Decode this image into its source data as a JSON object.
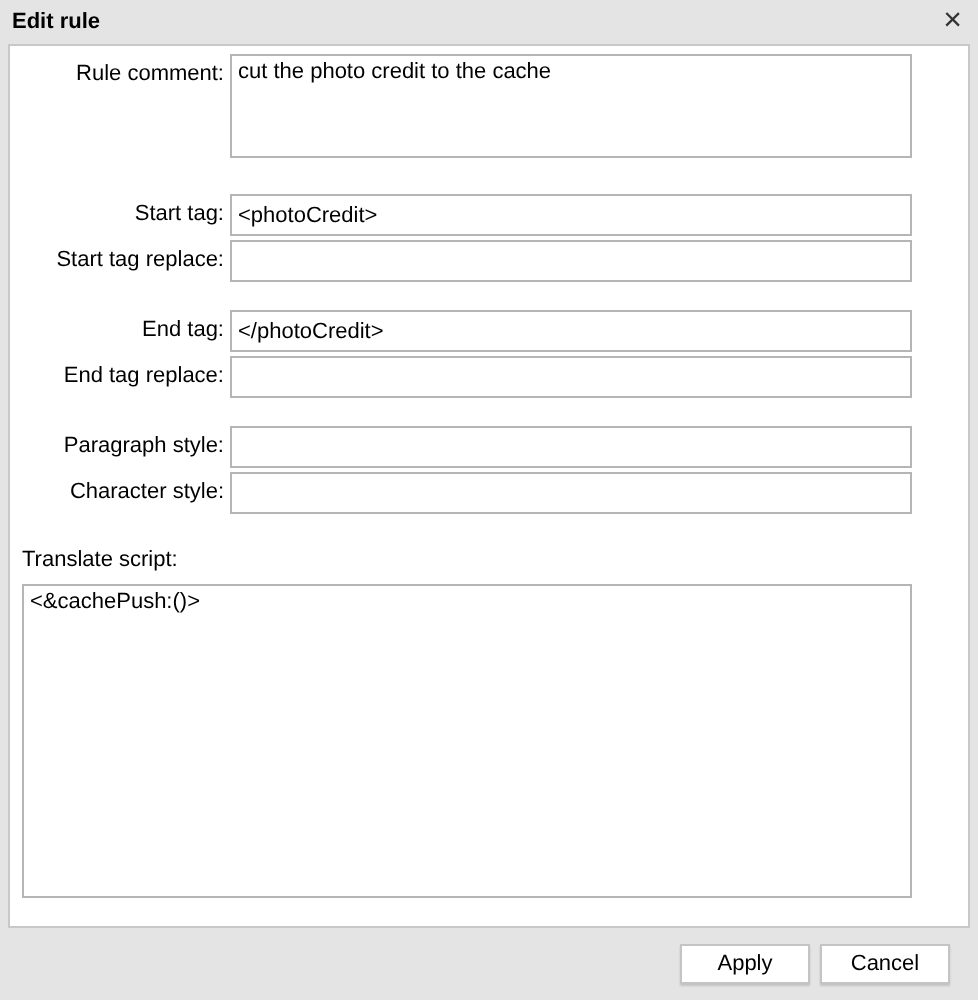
{
  "window": {
    "title": "Edit rule",
    "close": "×"
  },
  "field_groups": [
    [
      {
        "label": "Rule comment:",
        "kind": "multiline",
        "value": "cut the photo credit to the cache"
      }
    ],
    [
      {
        "label": "Start tag:",
        "kind": "line",
        "value": "<photoCredit>"
      },
      {
        "label": "Start tag replace:",
        "kind": "line"
      }
    ],
    [
      {
        "label": "End tag:",
        "kind": "line",
        "value": "</photoCredit>"
      },
      {
        "label": "End tag replace:",
        "kind": "line"
      }
    ],
    [
      {
        "label": "Paragraph style:",
        "kind": "line"
      },
      {
        "label": "Character style:",
        "kind": "line"
      }
    ]
  ],
  "script": {
    "label": "Translate script:",
    "value": "<&cachePush:()>"
  },
  "buttons": [
    "Apply",
    "Cancel"
  ]
}
